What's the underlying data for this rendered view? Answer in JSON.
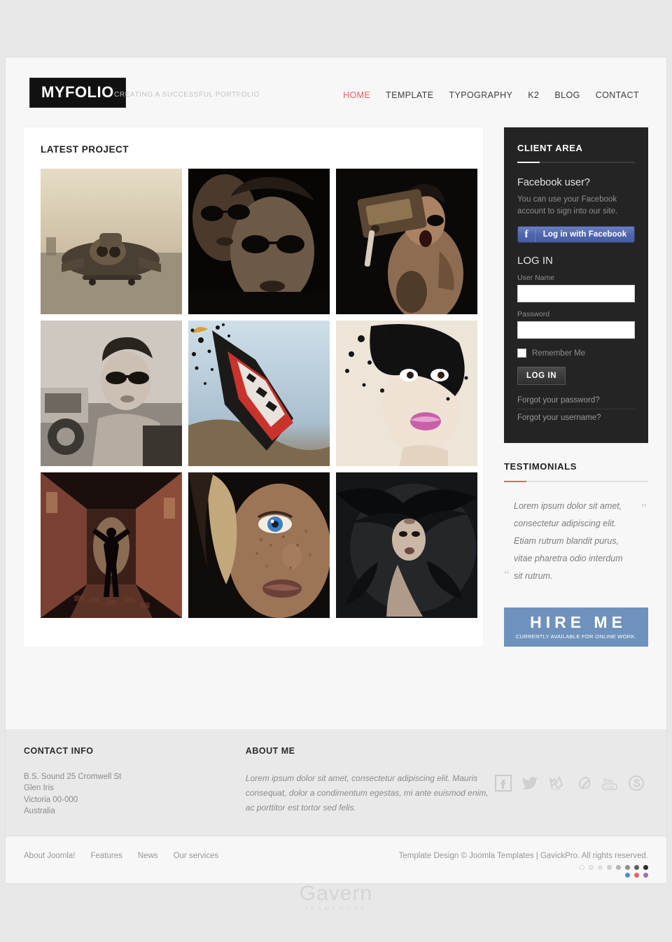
{
  "header": {
    "logo": "MYFOLIO",
    "tagline": "Creating a successful portfolio",
    "nav": [
      {
        "label": "HOME",
        "active": true
      },
      {
        "label": "TEMPLATE",
        "active": false
      },
      {
        "label": "TYPOGRAPHY",
        "active": false
      },
      {
        "label": "K2",
        "active": false
      },
      {
        "label": "BLOG",
        "active": false
      },
      {
        "label": "CONTACT",
        "active": false
      }
    ]
  },
  "main": {
    "panel_title": "LATEST PROJECT",
    "projects": [
      {
        "name": "skateboard-flyer",
        "alt": "Man flying on skateboard with goggles"
      },
      {
        "name": "two-men-sunglasses",
        "alt": "Two men wearing sunglasses in dark tones"
      },
      {
        "name": "shouting-man-radio",
        "alt": "Shirtless man shouting with vintage radio"
      },
      {
        "name": "man-car-sunglasses",
        "alt": "Man in sunglasses leaning out of classic car"
      },
      {
        "name": "exploding-sneaker",
        "alt": "Red sneaker sole exploding into particles"
      },
      {
        "name": "black-mask-woman",
        "alt": "Woman with black dispersion mask and pink lips"
      },
      {
        "name": "alley-silhouette",
        "alt": "Silhouette of person in narrow lit alley"
      },
      {
        "name": "blue-eye-freckles",
        "alt": "Close up portrait of freckled woman with blue eye"
      },
      {
        "name": "windblown-hair-woman",
        "alt": "Woman with dark windblown hair"
      }
    ]
  },
  "sidebar": {
    "client_area": {
      "title": "CLIENT AREA",
      "facebook_heading": "Facebook user?",
      "facebook_desc": "You can use your Facebook account to sign into our site.",
      "facebook_icon": "facebook-f-icon",
      "facebook_button": "Log in with Facebook",
      "login_heading": "LOG IN",
      "username_label": "User Name",
      "username_value": "",
      "username_placeholder": "",
      "password_label": "Password",
      "password_value": "",
      "password_placeholder": "",
      "remember_label": "Remember Me",
      "remember_checked": false,
      "login_button": "LOG IN",
      "forgot_password": "Forgot your password?",
      "forgot_username": "Forgot your username?"
    },
    "testimonials": {
      "title": "TESTIMONIALS",
      "quote_open": "“",
      "quote_close": "”",
      "quote": "Lorem ipsum dolor sit amet, consectetur adipiscing elit. Etiam rutrum blandit purus, vitae pharetra odio interdum sit rutrum."
    },
    "hire": {
      "title": "HIRE ME",
      "subtitle": "Currently available for online work.",
      "color": "#6f92bd"
    }
  },
  "footer": {
    "contact": {
      "title": "CONTACT INFO",
      "lines": [
        "B.S. Sound 25 Cromwell St",
        "Glen Iris",
        "Victoria 00-000",
        "Australia"
      ]
    },
    "about": {
      "title": "ABOUT ME",
      "paragraph": "Lorem ipsum dolor sit amet, consectetur adipiscing elit. Mauris consequat, dolor a condimentum egestas, mi ante euismod enim, ac porttitor est tortor sed felis."
    },
    "social": [
      {
        "name": "facebook-icon",
        "label": "Facebook"
      },
      {
        "name": "twitter-icon",
        "label": "Twitter"
      },
      {
        "name": "vimeo-icon",
        "label": "Vimeo"
      },
      {
        "name": "dribbble-icon",
        "label": "Dribbble"
      },
      {
        "name": "youtube-icon",
        "label": "YouTube"
      },
      {
        "name": "skype-icon",
        "label": "Skype"
      }
    ],
    "bottom_links": [
      "About Joomla!",
      "Features",
      "News",
      "Our services"
    ],
    "copyright": "Template Design © Joomla Templates | GavickPro. All rights reserved.",
    "swatches_row1": [
      "#ffffff",
      "#ececec",
      "#e0e0e0",
      "#cfcfcf",
      "#b6b6b6",
      "#8f8f8f",
      "#5f5f5f",
      "#2b2b2b"
    ],
    "swatches_row2": [
      "#4d8fd0",
      "#e8615f",
      "#9c6fae"
    ],
    "gavern_name": "Gavern",
    "gavern_sub": "Framework"
  },
  "colors": {
    "accent": "#e8615f",
    "page_bg": "#e8e8e8",
    "panel_bg": "#ffffff",
    "dark_panel": "#242424"
  }
}
